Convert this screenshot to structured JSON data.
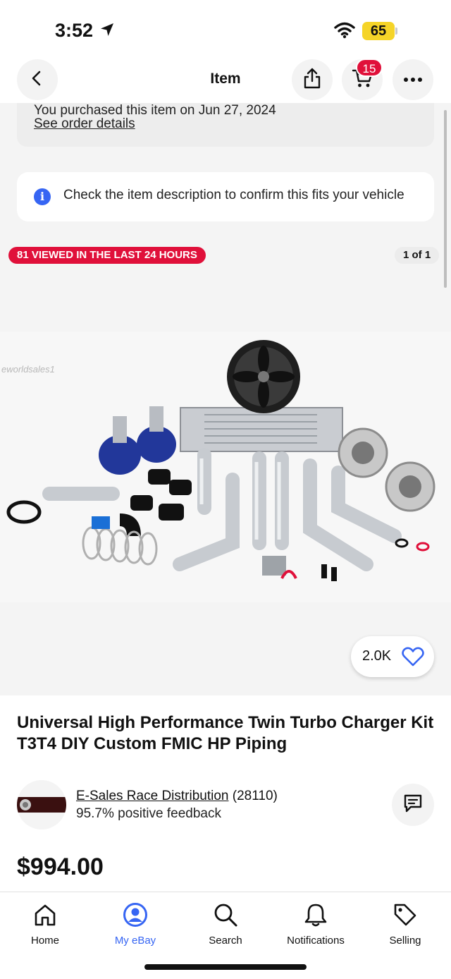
{
  "status_bar": {
    "time": "3:52",
    "battery": "65"
  },
  "header": {
    "title": "Item",
    "cart_count": "15"
  },
  "purchase": {
    "text": "You purchased this item on Jun 27, 2024",
    "link": "See order details"
  },
  "notice": {
    "text": "Check the item description to confirm this fits your vehicle"
  },
  "gallery": {
    "viewed_badge": "81 VIEWED IN THE LAST 24 HOURS",
    "page": "1 of 1",
    "watermark": "eworldsales1",
    "watch_count": "2.0K"
  },
  "item": {
    "title": "Universal High Performance Twin Turbo Charger Kit T3T4 DIY Custom FMIC HP Piping",
    "price": "$994.00"
  },
  "seller": {
    "name": "E-Sales Race Distribution",
    "count": "(28110)",
    "feedback": "95.7% positive feedback"
  },
  "tabs": [
    {
      "label": "Home",
      "icon": "home-icon"
    },
    {
      "label": "My eBay",
      "icon": "profile-icon"
    },
    {
      "label": "Search",
      "icon": "search-icon"
    },
    {
      "label": "Notifications",
      "icon": "bell-icon"
    },
    {
      "label": "Selling",
      "icon": "tag-icon"
    }
  ],
  "colors": {
    "accent": "#3665f3",
    "badge_red": "#e0103a",
    "battery": "#f5d428"
  }
}
